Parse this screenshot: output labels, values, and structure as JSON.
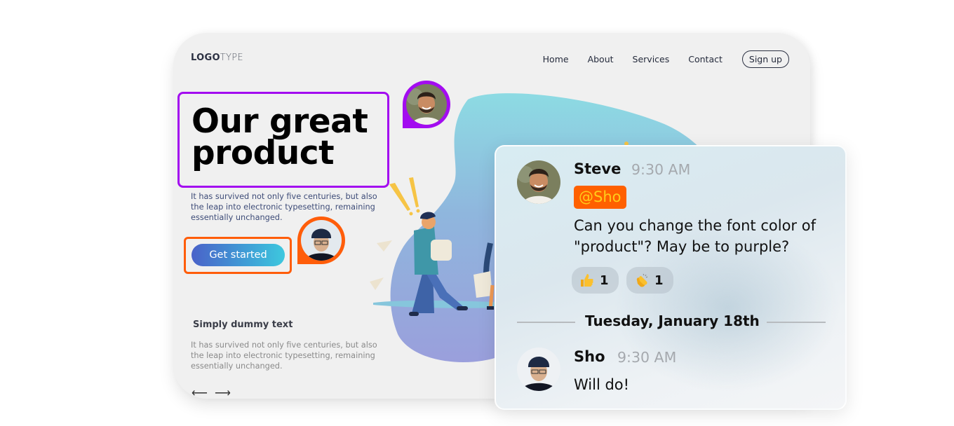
{
  "website": {
    "logo_bold": "LOGO",
    "logo_light": "TYPE",
    "nav": [
      "Home",
      "About",
      "Services",
      "Contact"
    ],
    "signup_label": "Sign up",
    "hero_title_line1": "Our great",
    "hero_title_line2": "product",
    "hero_description": "It has survived not only five centuries, but also the leap into electronic typesetting, remaining essentially unchanged.",
    "cta_label": "Get started",
    "sub_title": "Simply dummy text",
    "sub_description": "It has survived not only five centuries, but also the leap into electronic typesetting, remaining essentially unchanged.",
    "prev_arrow": "⟵",
    "next_arrow": "⟶"
  },
  "annotations": {
    "hero_highlight_color": "#a30cf0",
    "cta_highlight_color": "#ff5d0a"
  },
  "chat": {
    "messages": [
      {
        "author": "Steve",
        "time": "9:30 AM",
        "mention": "@Sho",
        "text_line1": "Can you change the font color of",
        "text_line2": "\"product\"? May be to purple?",
        "reactions": [
          {
            "icon": "thumbs-up-icon",
            "count": "1"
          },
          {
            "icon": "clapping-hands-icon",
            "count": "1"
          }
        ]
      },
      {
        "author": "Sho",
        "time": "9:30 AM",
        "text_line1": "Will do!"
      }
    ],
    "date_divider": "Tuesday, January 18th",
    "mention_bg": "#ff6000",
    "mention_fg": "#ffcc1a"
  }
}
